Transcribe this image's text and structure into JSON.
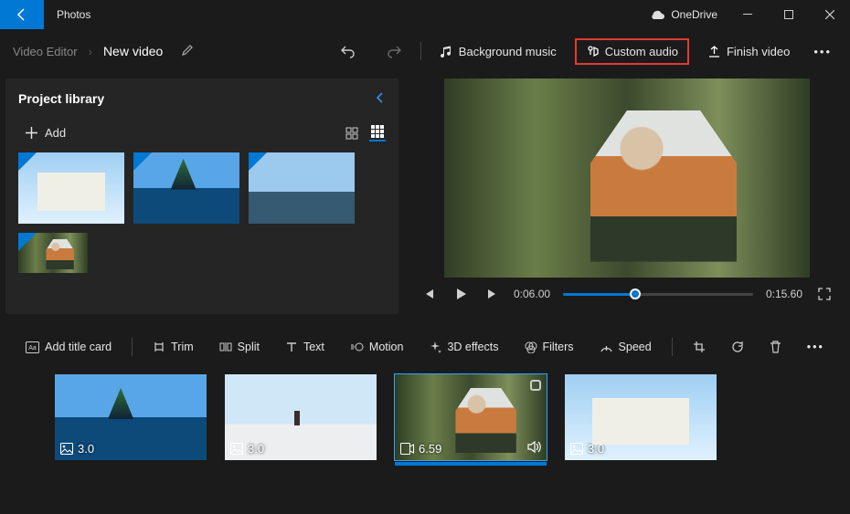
{
  "app_title": "Photos",
  "onedrive": "OneDrive",
  "breadcrumb": "Video Editor",
  "video_title": "New video",
  "top_actions": {
    "bg_music": "Background music",
    "custom_audio": "Custom audio",
    "finish": "Finish video"
  },
  "library": {
    "title": "Project library",
    "add": "Add"
  },
  "player": {
    "current": "0:06.00",
    "total": "0:15.60"
  },
  "story_tools": {
    "title_card": "Add title card",
    "trim": "Trim",
    "split": "Split",
    "text": "Text",
    "motion": "Motion",
    "fx": "3D effects",
    "filters": "Filters",
    "speed": "Speed"
  },
  "clips": [
    {
      "dur": "3.0"
    },
    {
      "dur": "3.0"
    },
    {
      "dur": "6.59"
    },
    {
      "dur": "3.0"
    }
  ]
}
